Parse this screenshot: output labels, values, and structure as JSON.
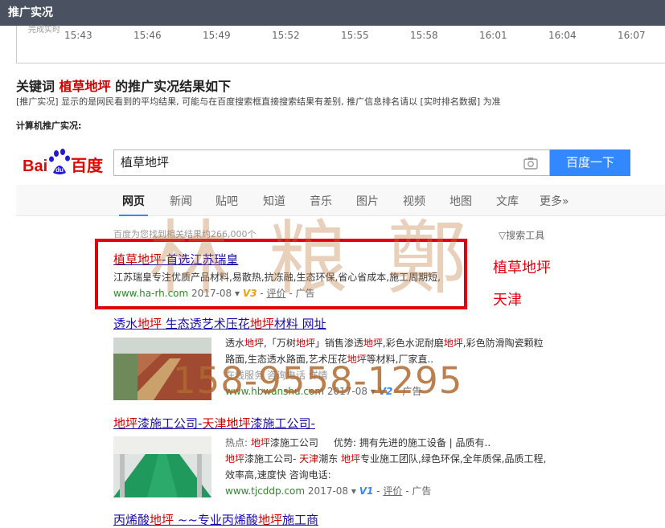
{
  "topbar": {
    "title": "推广实况"
  },
  "timeline": {
    "cut_label": "完成实时",
    "ticks": [
      "15:43",
      "15:46",
      "15:49",
      "15:52",
      "15:55",
      "15:58",
      "16:01",
      "16:04",
      "16:07"
    ]
  },
  "heading": {
    "prefix": "关键词 ",
    "keyword": "植草地坪",
    "suffix": " 的推广实况结果如下"
  },
  "note": "[推广实况] 显示的是网民看到的平均结果, 可能与在百度搜索框直接搜索结果有差别, 推广信息排名请以 [实时排名数据] 为准",
  "subhead": "计算机推广实况:",
  "search": {
    "query": "植草地坪",
    "button": "百度一下",
    "camera_icon": "camera-icon"
  },
  "logo": {
    "text_a": "Bai",
    "text_b": "百度",
    "paw_text": "du"
  },
  "tabs": [
    "网页",
    "新闻",
    "贴吧",
    "知道",
    "音乐",
    "图片",
    "视频",
    "地图",
    "文库",
    "更多»"
  ],
  "stats": "百度为您找到相关结果约266,000个",
  "tools": "搜索工具",
  "results": [
    {
      "title_parts": [
        {
          "t": "植草地坪",
          "em": true
        },
        {
          "t": "-首选江苏瑞皇",
          "em": false
        }
      ],
      "snippet": "江苏瑞皇专注优质产品材料,易散热,抗冻融,生态环保,省心省成本,施工周期短,",
      "url": "www.ha-rh.com",
      "date": "2017-08",
      "v": "V3",
      "eval": "评价",
      "ad": "广告"
    },
    {
      "title_parts": [
        {
          "t": "透水",
          "em": false
        },
        {
          "t": "地坪",
          "em": true
        },
        {
          "t": " 生态透艺术压花",
          "em": false
        },
        {
          "t": "地坪",
          "em": true
        },
        {
          "t": "材料 网址",
          "em": false
        }
      ],
      "snippet_parts": [
        {
          "t": "透水",
          "em": false
        },
        {
          "t": "地坪",
          "em": true
        },
        {
          "t": ",「万树",
          "em": false
        },
        {
          "t": "地坪",
          "em": true
        },
        {
          "t": "」销售渗透",
          "em": false
        },
        {
          "t": "地坪",
          "em": true
        },
        {
          "t": ",彩色水泥耐磨",
          "em": false
        },
        {
          "t": "地坪",
          "em": true
        },
        {
          "t": ",彩色防滑陶瓷颗粒路面,生态透水路面,艺术压花",
          "em": false
        },
        {
          "t": "地坪",
          "em": true
        },
        {
          "t": "等材料,厂家直..",
          "em": false
        }
      ],
      "line3": "在线服务  咨询电话  详情",
      "url": "www.hbwanshu.com",
      "date": "2017-08",
      "v": "V2",
      "ad": "广告"
    },
    {
      "title_parts": [
        {
          "t": "地坪",
          "em": true
        },
        {
          "t": "漆施工公司-",
          "em": false
        },
        {
          "t": "天津",
          "em": true
        },
        {
          "t": "地坪",
          "em": true
        },
        {
          "t": "漆施工公司-",
          "em": false
        }
      ],
      "hot": "热点: ",
      "hot_item": "地坪",
      "hot_item2": "漆施工公司",
      "adv": "优势: 拥有先进的施工设备 | 品质有..",
      "snippet_parts": [
        {
          "t": "地坪",
          "em": true
        },
        {
          "t": "漆施工公司- ",
          "em": false
        },
        {
          "t": "天津",
          "em": true
        },
        {
          "t": "潮东 ",
          "em": false
        },
        {
          "t": "地坪",
          "em": true
        },
        {
          "t": "专业施工团队,绿色环保,全年质保,品质工程,效率高,速度快 咨询电话:",
          "em": false
        }
      ],
      "url": "www.tjcddp.com",
      "date": "2017-08",
      "v": "V1",
      "eval": "评价",
      "ad": "广告"
    },
    {
      "title_parts": [
        {
          "t": "丙烯酸",
          "em": false
        },
        {
          "t": "地坪",
          "em": true
        },
        {
          "t": " ~~专业丙烯酸",
          "em": false
        },
        {
          "t": "地坪",
          "em": true
        },
        {
          "t": "施工商",
          "em": false
        }
      ]
    }
  ],
  "annotations": {
    "side1": "植草地坪",
    "side2": "天津",
    "phone": "158-9558-1295",
    "watermark": "林粮鄭"
  },
  "colors": {
    "topbar": "#4a5160",
    "link": "#1a0dab",
    "keyword": "#cc0000",
    "url": "#2b8a2b",
    "button": "#3388ff",
    "redbox": "#e0000f"
  }
}
